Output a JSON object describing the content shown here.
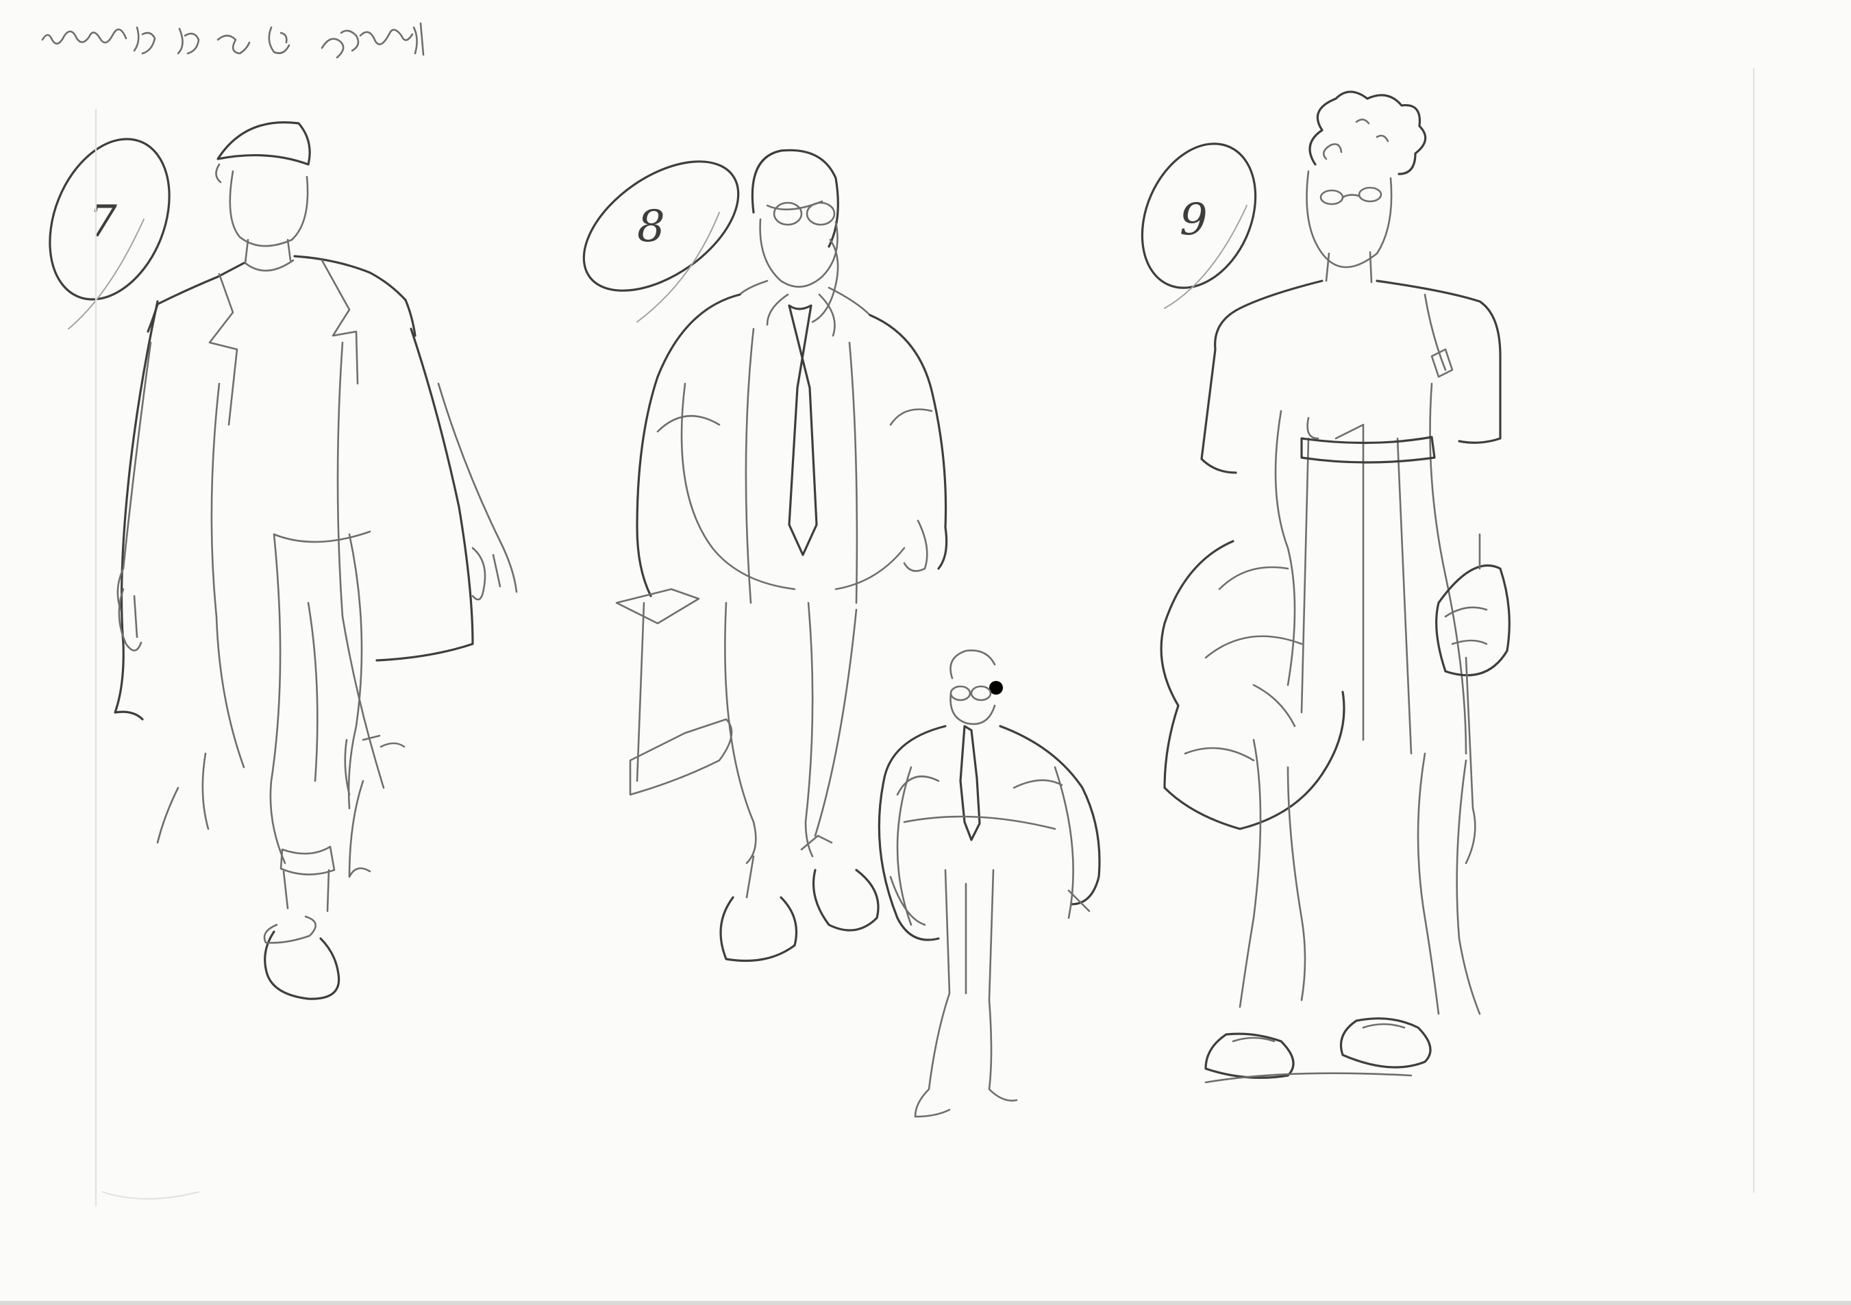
{
  "sketch": {
    "header_scribble": "",
    "figures": [
      {
        "number": "7"
      },
      {
        "number": "8"
      },
      {
        "number": "9"
      }
    ]
  },
  "colors": {
    "paper": "#fbfbf9",
    "pencil": "#6e6e6e",
    "pencil_dark": "#3e3e3e"
  }
}
